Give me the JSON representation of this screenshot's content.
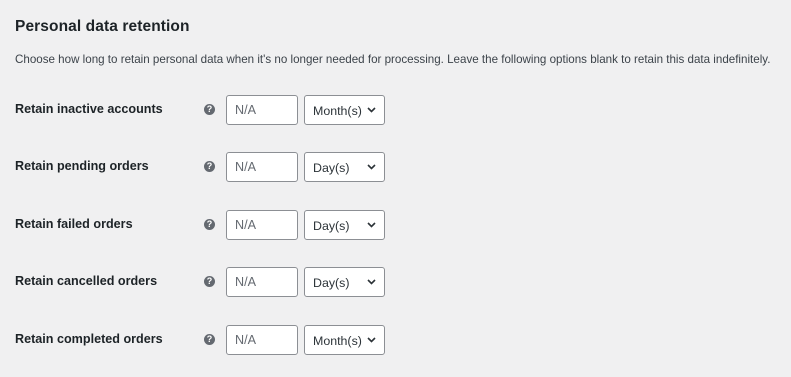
{
  "section": {
    "title": "Personal data retention",
    "description": "Choose how long to retain personal data when it's no longer needed for processing. Leave the following options blank to retain this data indefinitely."
  },
  "help_icon_glyph": "?",
  "rows": [
    {
      "label": "Retain inactive accounts",
      "value": "",
      "placeholder": "N/A",
      "unit": "Month(s)"
    },
    {
      "label": "Retain pending orders",
      "value": "",
      "placeholder": "N/A",
      "unit": "Day(s)"
    },
    {
      "label": "Retain failed orders",
      "value": "",
      "placeholder": "N/A",
      "unit": "Day(s)"
    },
    {
      "label": "Retain cancelled orders",
      "value": "",
      "placeholder": "N/A",
      "unit": "Day(s)"
    },
    {
      "label": "Retain completed orders",
      "value": "",
      "placeholder": "N/A",
      "unit": "Month(s)"
    }
  ],
  "colors": {
    "background": "#f0f0f1",
    "text": "#1d2327",
    "border": "#8c8f94",
    "help_icon": "#646970"
  }
}
